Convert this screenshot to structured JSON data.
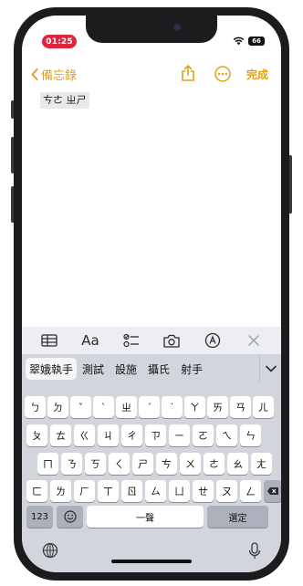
{
  "status_bar": {
    "time": "01:25",
    "battery": "66"
  },
  "nav": {
    "back_label": "備忘錄",
    "done_label": "完成",
    "icons": [
      "share-icon",
      "more-icon"
    ]
  },
  "note": {
    "text": "ㄘㄜ ㄓㄕ"
  },
  "format_bar": {
    "text_format_label": "Aa",
    "icons": [
      "table-icon",
      "checklist-icon",
      "camera-icon",
      "markup-icon",
      "close-icon"
    ]
  },
  "candidates": [
    "翠娥執手",
    "測試",
    "設施",
    "攝氏",
    "射手"
  ],
  "keyboard": {
    "rows": [
      [
        "ㄅ",
        "ㄉ",
        "ˇ",
        "ˋ",
        "ㄓ",
        "ˊ",
        "˙",
        "ㄚ",
        "ㄞ",
        "ㄢ",
        "ㄦ"
      ],
      [
        "ㄆ",
        "ㄊ",
        "ㄍ",
        "ㄐ",
        "ㄔ",
        "ㄗ",
        "ㄧ",
        "ㄛ",
        "ㄟ",
        "ㄣ"
      ],
      [
        "ㄇ",
        "ㄋ",
        "ㄎ",
        "ㄑ",
        "ㄕ",
        "ㄘ",
        "ㄨ",
        "ㄜ",
        "ㄠ",
        "ㄤ"
      ],
      [
        "ㄈ",
        "ㄌ",
        "ㄏ",
        "ㄒ",
        "ㄖ",
        "ㄙ",
        "ㄩ",
        "ㄝ",
        "ㄡ",
        "ㄥ"
      ]
    ],
    "num_label": "123",
    "space_label": "一聲",
    "return_label": "選定"
  }
}
